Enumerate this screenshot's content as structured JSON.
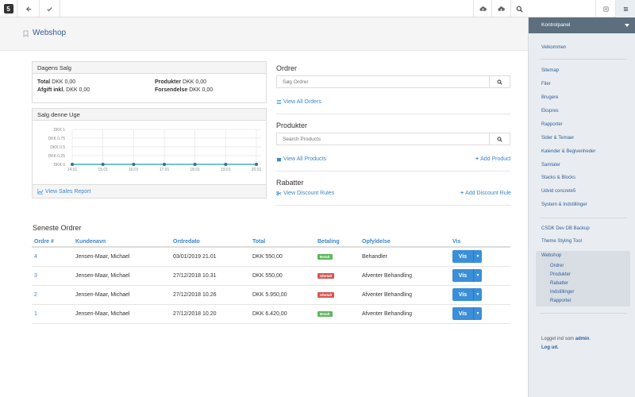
{
  "page_title": "Webshop",
  "search": {
    "placeholder": ""
  },
  "sales_today": {
    "title": "Dagens Salg",
    "total_label": "Total",
    "total_value": "DKK 0,00",
    "tax_label": "Afgift inkl.",
    "tax_value": "DKK 0,00",
    "products_label": "Produkter",
    "products_value": "DKK 0,00",
    "shipping_label": "Forsendelse",
    "shipping_value": "DKK 0,00"
  },
  "sales_week": {
    "title": "Salg denne Uge",
    "report_link": "View Sales Report"
  },
  "chart_data": {
    "type": "line",
    "categories": [
      "14.01",
      "15.01",
      "16.01",
      "17.01",
      "18.01",
      "19.01",
      "20.01"
    ],
    "values": [
      0,
      0,
      0,
      0,
      0,
      0,
      0
    ],
    "yticks": [
      "DKK 0",
      "DKK 0.25",
      "DKK 0.5",
      "DKK 0.75",
      "DKK 1"
    ],
    "ylim": [
      0,
      1
    ],
    "grid": true,
    "line_color": "#21a0b5"
  },
  "orders_section": {
    "title": "Ordrer",
    "search_placeholder": "Søg Ordrer",
    "view_all": "View All Orders"
  },
  "products_section": {
    "title": "Produkter",
    "search_placeholder": "Search Products",
    "view_all": "View All Products",
    "add": "Add Product"
  },
  "discounts_section": {
    "title": "Rabatter",
    "view_rules": "View Discount Rules",
    "add": "Add Discount Rule"
  },
  "latest_orders": {
    "title": "Seneste Ordrer",
    "columns": [
      "Ordre #",
      "Kundenavn",
      "Ordredato",
      "Total",
      "Betaling",
      "Opfyldelse",
      "Vis"
    ],
    "rows": [
      {
        "id": "4",
        "customer": "Jensen-Maar, Michael",
        "date": "03/01/2019 21.01",
        "total": "DKK 550,00",
        "payment": "Betalt",
        "payment_color": "#5cb85c",
        "fulfillment": "Behandler",
        "action": "Vis"
      },
      {
        "id": "3",
        "customer": "Jensen-Maar, Michael",
        "date": "27/12/2018 10.31",
        "total": "DKK 550,00",
        "payment": "Ubetalt",
        "payment_color": "#d9534f",
        "fulfillment": "Afventer Behandling",
        "action": "Vis"
      },
      {
        "id": "2",
        "customer": "Jensen-Maar, Michael",
        "date": "27/12/2018 10.26",
        "total": "DKK 5.950,00",
        "payment": "Ubetalt",
        "payment_color": "#d9534f",
        "fulfillment": "Afventer Behandling",
        "action": "Vis"
      },
      {
        "id": "1",
        "customer": "Jensen-Maar, Michael",
        "date": "27/12/2018 10.20",
        "total": "DKK 6.420,00",
        "payment": "Betalt",
        "payment_color": "#5cb85c",
        "fulfillment": "Afventer Behandling",
        "action": "Vis"
      }
    ]
  },
  "sidebar": {
    "header": "Kontrolpanel",
    "welcome": "Velkommen",
    "items": [
      "Sitemap",
      "Filer",
      "Brugere",
      "Ekspres",
      "Rapporter",
      "Sider & Temaer",
      "Kalender & Begivenheder",
      "Samtaler",
      "Stacks & Blocks",
      "Udvid concrete5",
      "System & Indstillinger"
    ],
    "extra": [
      "CSDK Dev DB Backup",
      "Theme Styling Tool"
    ],
    "webshop": "Webshop",
    "webshop_sub": [
      "Ordrer",
      "Produkter",
      "Rabatter",
      "Indstillinger",
      "Rapporter"
    ],
    "logged_in_prefix": "Logget ind som",
    "user": "admin",
    "logout": "Log ud."
  }
}
